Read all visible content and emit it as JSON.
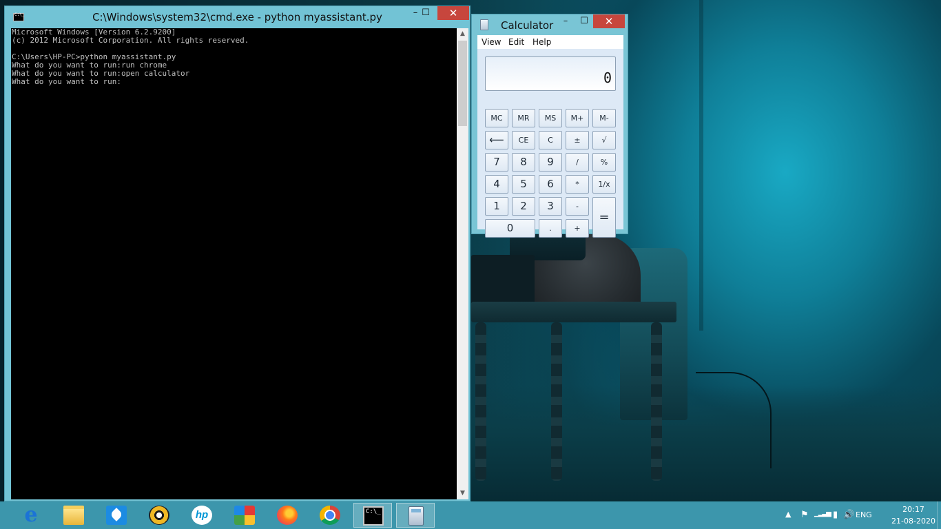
{
  "cmd": {
    "title": "C:\\Windows\\system32\\cmd.exe - python  myassistant.py",
    "lines": [
      "Microsoft Windows [Version 6.2.9200]",
      "(c) 2012 Microsoft Corporation. All rights reserved.",
      "",
      "C:\\Users\\HP-PC>python myassistant.py",
      "What do you want to run:run chrome",
      "What do you want to run:open calculator",
      "What do you want to run:"
    ]
  },
  "window_controls": {
    "minimize": "–",
    "maximize": "☐",
    "close": "✕"
  },
  "calculator": {
    "title": "Calculator",
    "menu": {
      "view": "View",
      "edit": "Edit",
      "help": "Help"
    },
    "display": "0",
    "keys": {
      "mc": "MC",
      "mr": "MR",
      "ms": "MS",
      "mplus": "M+",
      "mminus": "M-",
      "backspace": "⟵",
      "ce": "CE",
      "c": "C",
      "plusminus": "±",
      "sqrt": "√",
      "k7": "7",
      "k8": "8",
      "k9": "9",
      "divide": "/",
      "percent": "%",
      "k4": "4",
      "k5": "5",
      "k6": "6",
      "multiply": "*",
      "reciprocal": "1/x",
      "k1": "1",
      "k2": "2",
      "k3": "3",
      "subtract": "-",
      "equals": "=",
      "k0": "0",
      "decimal": ".",
      "add": "+"
    }
  },
  "taskbar": {
    "pinned": [
      "internet-explorer-icon",
      "file-explorer-icon",
      "rocket-app-icon",
      "gom-player-icon",
      "hp-icon",
      "puzzle-app-icon",
      "firefox-icon",
      "chrome-icon"
    ],
    "running": [
      "command-prompt-icon",
      "calculator-icon"
    ]
  },
  "tray": {
    "language": "ENG",
    "time": "20:17",
    "date": "21-08-2020"
  }
}
